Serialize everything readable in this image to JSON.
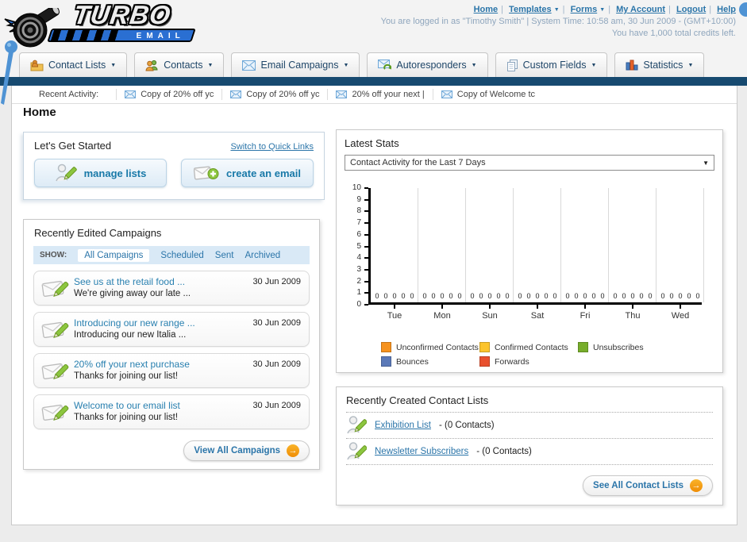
{
  "header": {
    "logo": {
      "word1": "TURBO",
      "word2": "EMAIL"
    },
    "links": [
      {
        "label": "Home",
        "dropdown": false
      },
      {
        "label": "Templates",
        "dropdown": true
      },
      {
        "label": "Forms",
        "dropdown": true
      },
      {
        "label": "My Account",
        "dropdown": false
      },
      {
        "label": "Logout",
        "dropdown": false
      },
      {
        "label": "Help",
        "dropdown": false
      }
    ],
    "login_info": "You are logged in as \"Timothy Smith\" | System Time: 10:58 am, 30 Jun 2009 - (GMT+10:00)",
    "credits": "You have 1,000 total credits left."
  },
  "nav": {
    "tabs": [
      {
        "label": "Contact Lists",
        "icon": "contact-lists-icon"
      },
      {
        "label": "Contacts",
        "icon": "contacts-icon"
      },
      {
        "label": "Email Campaigns",
        "icon": "email-campaigns-icon"
      },
      {
        "label": "Autoresponders",
        "icon": "autoresponders-icon"
      },
      {
        "label": "Custom Fields",
        "icon": "custom-fields-icon"
      },
      {
        "label": "Statistics",
        "icon": "statistics-icon"
      }
    ]
  },
  "recent_activity": {
    "label": "Recent Activity:",
    "items": [
      "Copy of 20% off yc",
      "Copy of 20% off yc",
      "20% off your next |",
      "Copy of Welcome tc"
    ]
  },
  "page": {
    "title": "Home"
  },
  "get_started": {
    "title": "Let's Get Started",
    "switch_link": "Switch to Quick Links",
    "buttons": [
      {
        "label": "manage lists"
      },
      {
        "label": "create an email"
      }
    ]
  },
  "campaigns": {
    "title": "Recently Edited Campaigns",
    "show_label": "SHOW:",
    "filters": [
      "All Campaigns",
      "Scheduled",
      "Sent",
      "Archived"
    ],
    "active_filter": "All Campaigns",
    "items": [
      {
        "title": "See us at the retail food ...",
        "subtitle": "We're giving away our late ...",
        "date": "30 Jun 2009"
      },
      {
        "title": "Introducing our new range ...",
        "subtitle": "Introducing our new Italia ...",
        "date": "30 Jun 2009"
      },
      {
        "title": "20% off your next purchase",
        "subtitle": "Thanks for joining our list!",
        "date": "30 Jun 2009"
      },
      {
        "title": "Welcome to our email list",
        "subtitle": "Thanks for joining our list!",
        "date": "30 Jun 2009"
      }
    ],
    "view_all_label": "View All Campaigns"
  },
  "stats": {
    "title": "Latest Stats",
    "dropdown_value": "Contact Activity for the Last 7 Days"
  },
  "chart_data": {
    "type": "bar",
    "title": "Contact Activity for the Last 7 Days",
    "categories": [
      "Tue",
      "Mon",
      "Sun",
      "Sat",
      "Fri",
      "Thu",
      "Wed"
    ],
    "series": [
      {
        "name": "Unconfirmed Contacts",
        "color": "#F6921E",
        "values": [
          0,
          0,
          0,
          0,
          0,
          0,
          0
        ]
      },
      {
        "name": "Confirmed Contacts",
        "color": "#FCC42C",
        "values": [
          0,
          0,
          0,
          0,
          0,
          0,
          0
        ]
      },
      {
        "name": "Unsubscribes",
        "color": "#77AD2B",
        "values": [
          0,
          0,
          0,
          0,
          0,
          0,
          0
        ]
      },
      {
        "name": "Bounces",
        "color": "#5B79B8",
        "values": [
          0,
          0,
          0,
          0,
          0,
          0,
          0
        ]
      },
      {
        "name": "Forwards",
        "color": "#E8502E",
        "values": [
          0,
          0,
          0,
          0,
          0,
          0,
          0
        ]
      }
    ],
    "xlabel": "",
    "ylabel": "",
    "ylim": [
      0,
      10
    ],
    "yticks": [
      0,
      1,
      2,
      3,
      4,
      5,
      6,
      7,
      8,
      9,
      10
    ],
    "grid": "vertical-group-separators",
    "legend_position": "bottom",
    "value_labels_shown": true
  },
  "contact_lists": {
    "title": "Recently Created Contact Lists",
    "items": [
      {
        "name": "Exhibition List",
        "suffix": " - (0 Contacts)"
      },
      {
        "name": "Newsletter Subscribers",
        "suffix": " - (0 Contacts)"
      }
    ],
    "see_all_label": "See All Contact Lists"
  }
}
